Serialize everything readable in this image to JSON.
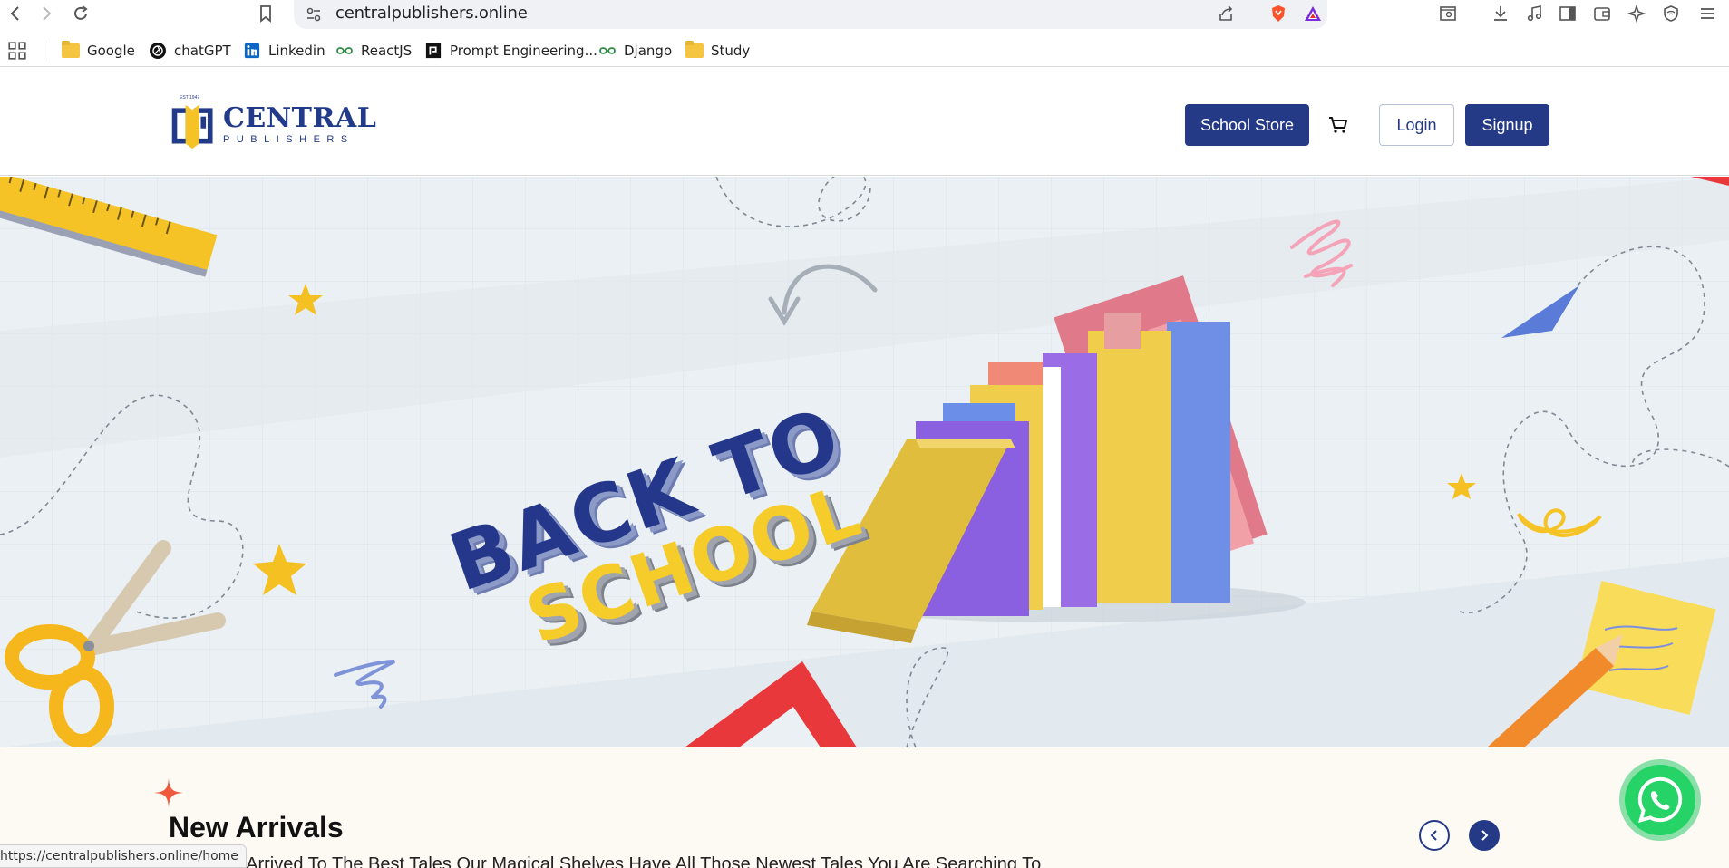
{
  "browser": {
    "url": "centralpublishers.online",
    "status_url": "https://centralpublishers.online/home"
  },
  "bookmarks": [
    {
      "label": "Google",
      "icon": "folder-icon"
    },
    {
      "label": "chatGPT",
      "icon": "chatgpt-icon"
    },
    {
      "label": "Linkedin",
      "icon": "linkedin-icon"
    },
    {
      "label": "ReactJS",
      "icon": "gfg-icon"
    },
    {
      "label": "Prompt Engineering...",
      "icon": "prompt-icon"
    },
    {
      "label": "Django",
      "icon": "gfg-icon"
    },
    {
      "label": "Study",
      "icon": "folder-icon"
    }
  ],
  "site": {
    "logo_title": "CENTRAL",
    "logo_subtitle": "PUBLISHERS",
    "logo_est": "EST 1947",
    "nav": {
      "school_store": "School Store",
      "login": "Login",
      "signup": "Signup"
    }
  },
  "hero": {
    "line1": "BACK TO",
    "line2": "SCHOOL"
  },
  "arrivals": {
    "title": "New Arrivals",
    "description": "Just Arrived To The Best Tales Our Magical Shelves Have All Those Newest Tales You Are Searching To"
  },
  "colors": {
    "brand": "#253a86",
    "accent_yellow": "#f6cc2a",
    "whatsapp": "#25d366"
  }
}
